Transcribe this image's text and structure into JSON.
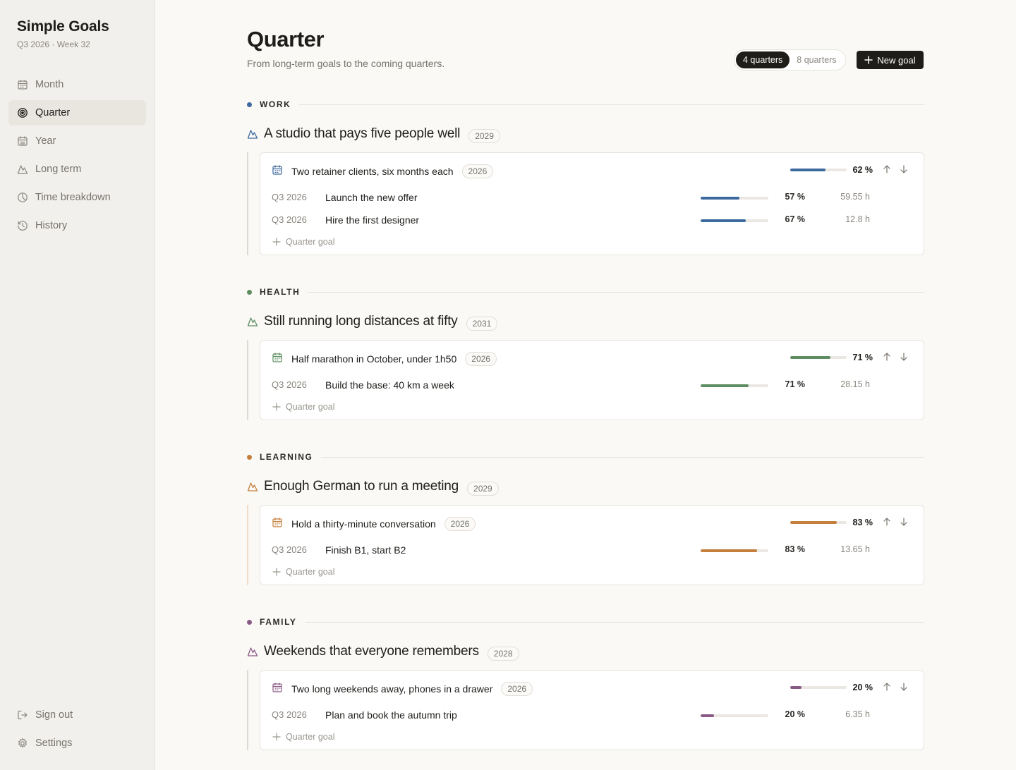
{
  "sidebar": {
    "title": "Simple Goals",
    "subtitle": "Q3 2026 · Week 32",
    "nav": [
      {
        "label": "Month",
        "icon": "calendar-icon"
      },
      {
        "label": "Quarter",
        "icon": "target-icon",
        "active": true
      },
      {
        "label": "Year",
        "icon": "calendar-grid-icon"
      },
      {
        "label": "Long term",
        "icon": "mountain-icon"
      },
      {
        "label": "Time breakdown",
        "icon": "pie-chart-icon"
      },
      {
        "label": "History",
        "icon": "history-icon"
      }
    ],
    "bottom": [
      {
        "label": "Sign out",
        "icon": "sign-out-icon"
      },
      {
        "label": "Settings",
        "icon": "gear-icon"
      }
    ]
  },
  "header": {
    "title": "Quarter",
    "subtitle": "From long-term goals to the coming quarters.",
    "range_options": [
      "4 quarters",
      "8 quarters"
    ],
    "range_selected": "4 quarters",
    "new_goal_label": "New goal"
  },
  "add_quarter_goal_label": "Quarter goal",
  "sections": [
    {
      "category": "WORK",
      "color": "#3d6a9e",
      "rail_color": "#dedad3",
      "long_term": {
        "title": "A studio that pays five people well",
        "year": "2029"
      },
      "year_goal": {
        "title": "Two retainer clients, six months each",
        "year": "2026",
        "progress": 0.62,
        "percent": "62 %"
      },
      "quarter_goals": [
        {
          "quarter": "Q3 2026",
          "title": "Launch the new offer",
          "progress": 0.57,
          "percent": "57 %",
          "hours": "59.55 h"
        },
        {
          "quarter": "Q3 2026",
          "title": "Hire the first designer",
          "progress": 0.67,
          "percent": "67 %",
          "hours": "12.8 h"
        }
      ]
    },
    {
      "category": "HEALTH",
      "color": "#5e8d61",
      "rail_color": "#dedad3",
      "long_term": {
        "title": "Still running long distances at fifty",
        "year": "2031"
      },
      "year_goal": {
        "title": "Half marathon in October, under 1h50",
        "year": "2026",
        "progress": 0.71,
        "percent": "71 %"
      },
      "quarter_goals": [
        {
          "quarter": "Q3 2026",
          "title": "Build the base: 40 km a week",
          "progress": 0.71,
          "percent": "71 %",
          "hours": "28.15 h"
        }
      ]
    },
    {
      "category": "LEARNING",
      "color": "#c47f3c",
      "rail_color": "#f0dcc6",
      "long_term": {
        "title": "Enough German to run a meeting",
        "year": "2029"
      },
      "year_goal": {
        "title": "Hold a thirty-minute conversation",
        "year": "2026",
        "progress": 0.83,
        "percent": "83 %"
      },
      "quarter_goals": [
        {
          "quarter": "Q3 2026",
          "title": "Finish B1, start B2",
          "progress": 0.83,
          "percent": "83 %",
          "hours": "13.65 h"
        }
      ]
    },
    {
      "category": "FAMILY",
      "color": "#8a5a86",
      "rail_color": "#dedad3",
      "long_term": {
        "title": "Weekends that everyone remembers",
        "year": "2028"
      },
      "year_goal": {
        "title": "Two long weekends away, phones in a drawer",
        "year": "2026",
        "progress": 0.2,
        "percent": "20 %"
      },
      "quarter_goals": [
        {
          "quarter": "Q3 2026",
          "title": "Plan and book the autumn trip",
          "progress": 0.2,
          "percent": "20 %",
          "hours": "6.35 h"
        }
      ]
    }
  ]
}
